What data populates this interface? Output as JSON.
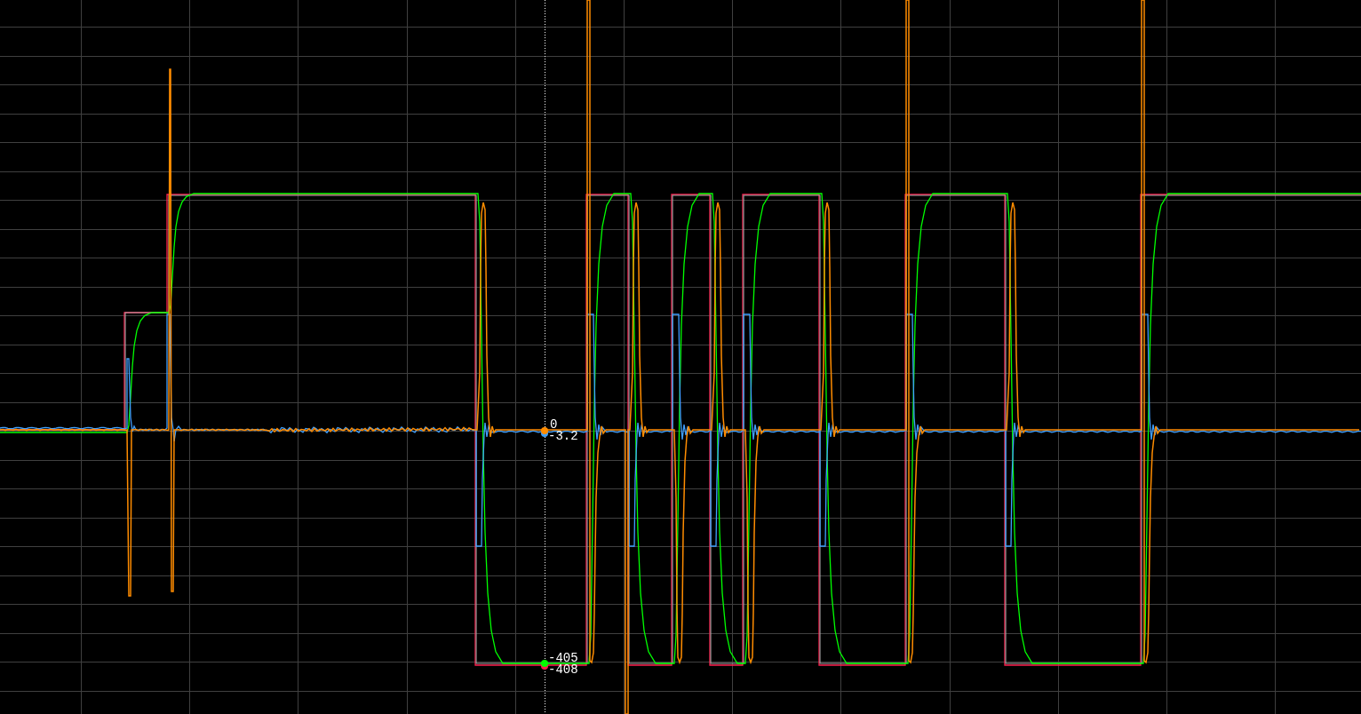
{
  "plot": {
    "cursor": {
      "markers": [
        {
          "color": "#ff8c00",
          "readout": "0"
        },
        {
          "color": "#3fa0ff",
          "readout": "-3.2"
        },
        {
          "color": "#00ff00",
          "readout": "-405"
        },
        {
          "color": "#ff1f4f",
          "readout": "-408"
        }
      ]
    }
  }
}
